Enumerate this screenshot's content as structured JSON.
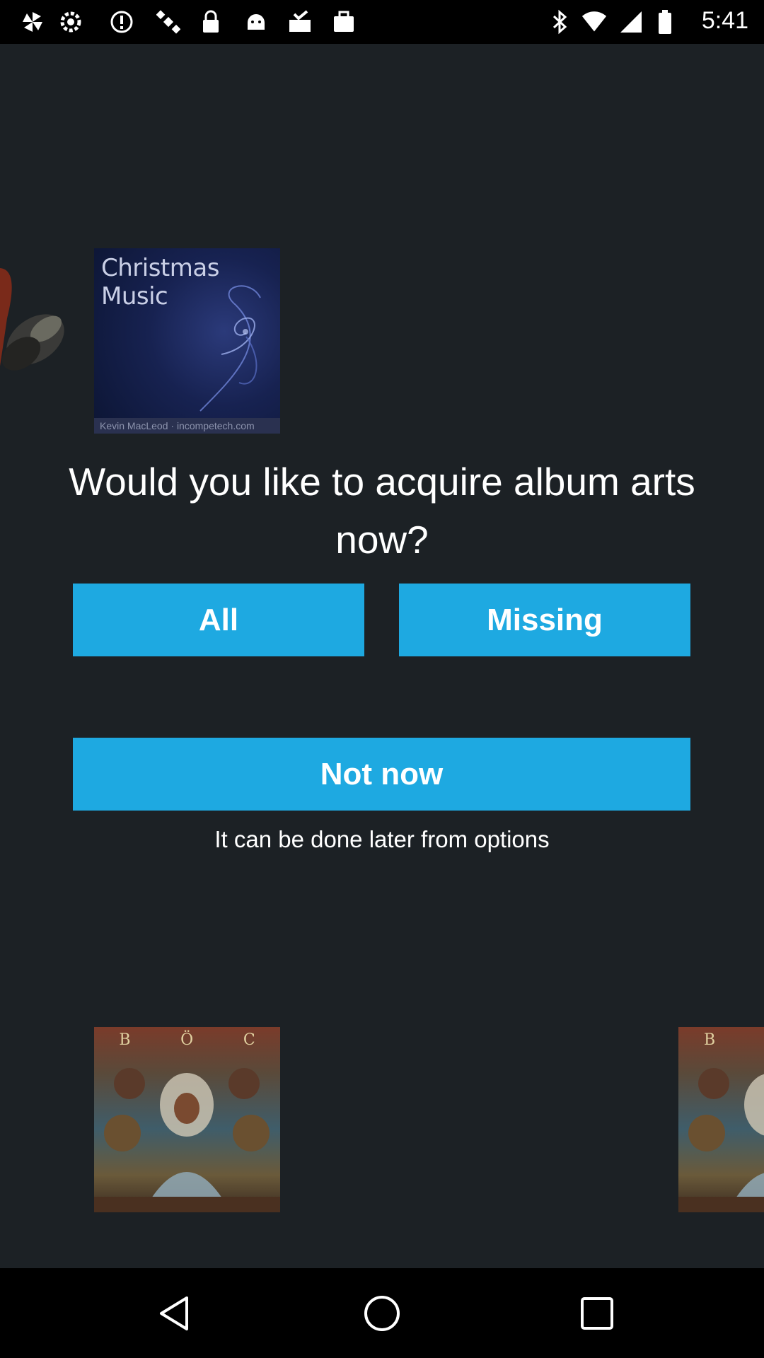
{
  "status_bar": {
    "time": "5:41",
    "icons": [
      "pinwheel-icon",
      "settings-icon",
      "alert-icon",
      "satellite-icon",
      "lock-icon",
      "android-icon",
      "clipboard-check-icon",
      "bag-icon",
      "bluetooth-icon",
      "wifi-icon",
      "signal-icon",
      "battery-icon"
    ]
  },
  "album_art": {
    "christmas_title": "Christmas Music",
    "christmas_footer": "Kevin MacLeod · incompetech.com",
    "boc_letters": [
      "B",
      "Ö",
      "C"
    ]
  },
  "dialog": {
    "prompt": "Would you like to acquire album arts now?",
    "all_label": "All",
    "missing_label": "Missing",
    "not_now_label": "Not now",
    "hint": "It can be done later from options"
  },
  "colors": {
    "background": "#1c2125",
    "accent": "#1ea9e1"
  },
  "nav_bar": {
    "icons": [
      "back-icon",
      "home-icon",
      "recents-icon"
    ]
  }
}
